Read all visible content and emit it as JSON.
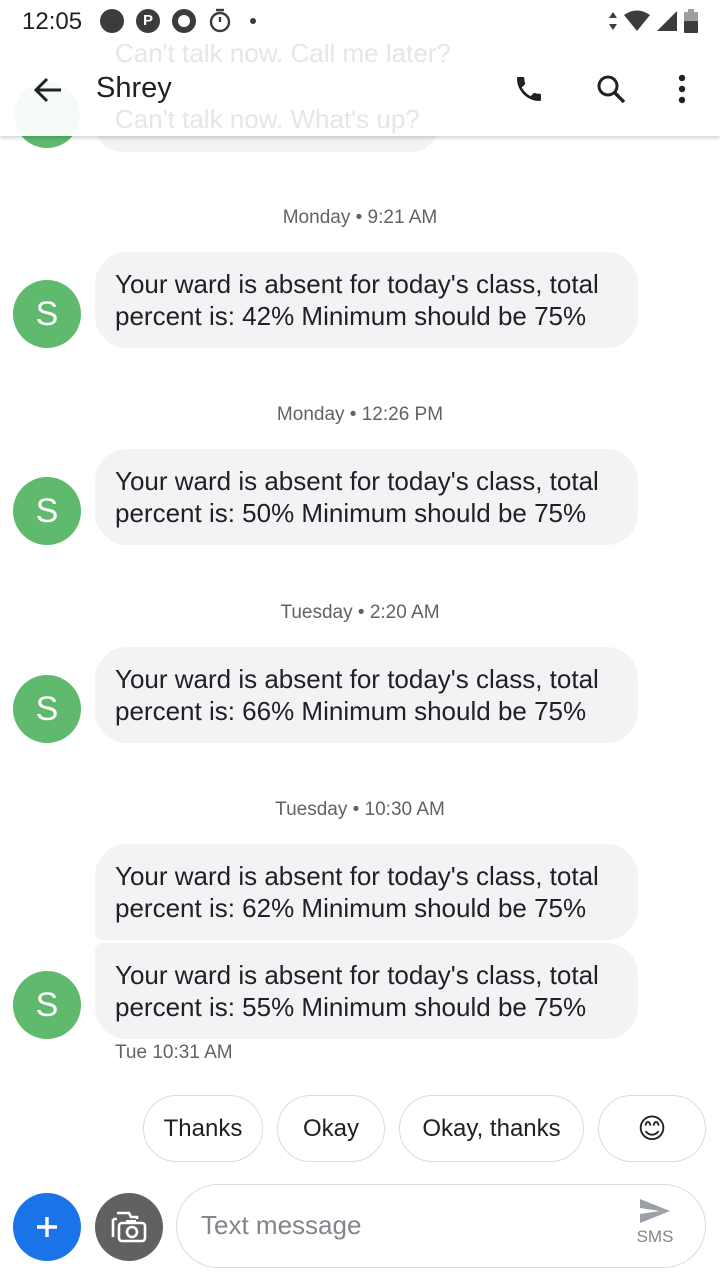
{
  "status_bar": {
    "time": "12:05",
    "icons": [
      "notification-dot-icon",
      "pinterest-icon",
      "ring-icon",
      "timer-icon",
      "more-notifications-dot-icon",
      "data-arrows-icon",
      "wifi-icon",
      "signal-icon",
      "battery-icon"
    ]
  },
  "app_bar": {
    "title": "Shrey",
    "ghost_line_1": "Can't talk now. Call me later?",
    "ghost_line_2": "Can't talk now. What's up?"
  },
  "messages": [
    {
      "timestamp": "Monday • 9:21 AM",
      "avatar": "S",
      "text": "Your ward is absent for today's class, total percent is: 42% Minimum should be 75%"
    },
    {
      "timestamp": "Monday • 12:26 PM",
      "avatar": "S",
      "text": "Your ward is absent for today's class, total percent is: 50% Minimum should be 75%"
    },
    {
      "timestamp": "Tuesday • 2:20 AM",
      "avatar": "S",
      "text": "Your ward is absent for today's class, total percent is: 66% Minimum should be 75%"
    },
    {
      "timestamp": "Tuesday • 10:30 AM",
      "avatar": "S",
      "text": "Your ward is absent for today's class, total percent is: 62% Minimum should be 75%"
    },
    {
      "avatar": "S",
      "text": "Your ward is absent for today's class, total percent is: 55% Minimum should be 75%",
      "meta": "Tue 10:31 AM"
    }
  ],
  "smart_replies": [
    "Thanks",
    "Okay",
    "Okay, thanks",
    "😊"
  ],
  "compose": {
    "placeholder": "Text message",
    "send_label": "SMS"
  },
  "colors": {
    "avatar": "#5fba6d",
    "bubble": "#f1f3f4",
    "fab": "#1a73e8",
    "camera": "#616161"
  }
}
